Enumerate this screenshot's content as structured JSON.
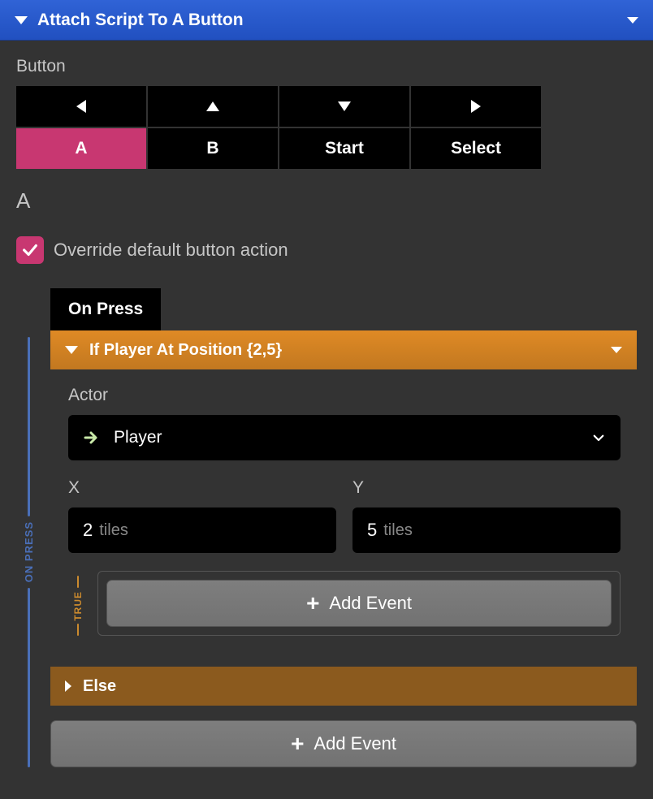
{
  "header": {
    "title": "Attach Script To A Button"
  },
  "button_section": {
    "label": "Button",
    "buttons": {
      "a": "A",
      "b": "B",
      "start": "Start",
      "select": "Select"
    }
  },
  "selected_button": "A",
  "override": {
    "checked": true,
    "label": "Override default button action"
  },
  "tab": {
    "on_press": "On Press"
  },
  "rail": {
    "on_press": "ON PRESS",
    "true": "TRUE"
  },
  "event": {
    "title": "If Player At Position {2,5}",
    "actor_label": "Actor",
    "actor_value": "Player",
    "x_label": "X",
    "y_label": "Y",
    "x_value": "2",
    "y_value": "5",
    "unit": "tiles",
    "else_label": "Else"
  },
  "add_event_label": "Add Event",
  "colors": {
    "accent_blue": "#2a57c8",
    "accent_pink": "#c83771",
    "accent_orange": "#d48426"
  }
}
